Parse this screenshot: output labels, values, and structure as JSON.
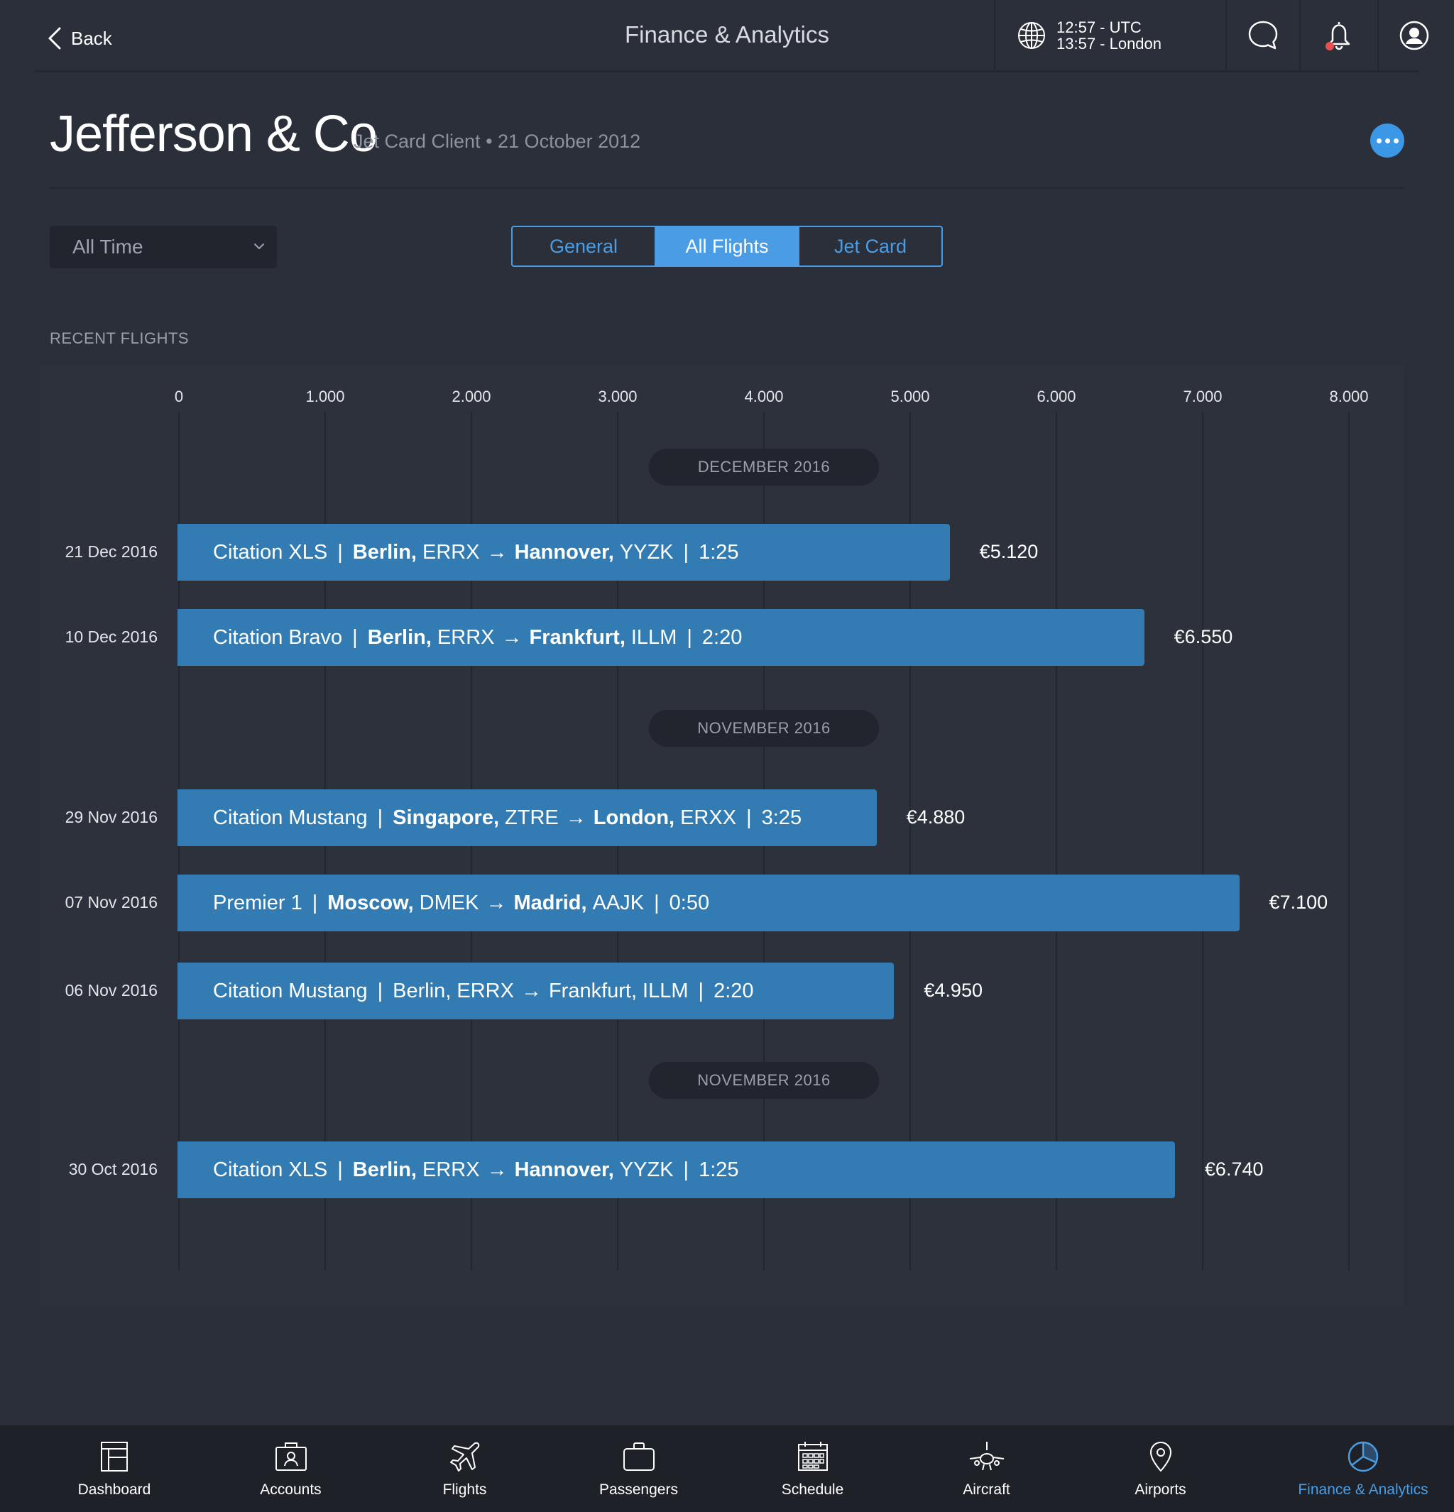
{
  "header": {
    "back_label": "Back",
    "title": "Finance & Analytics",
    "clock": {
      "utc": "12:57 - UTC",
      "local": "13:57 - London"
    },
    "notification_dot_color": "#e8504f"
  },
  "client": {
    "name": "Jefferson & Co",
    "meta": "Jet Card Client • 21 October 2012"
  },
  "filters": {
    "timeframe": "All Time",
    "tabs": [
      {
        "label": "General",
        "active": false
      },
      {
        "label": "All Flights",
        "active": true
      },
      {
        "label": "Jet Card",
        "active": false
      }
    ]
  },
  "section_label": "RECENT FLIGHTS",
  "chart_data": {
    "type": "bar",
    "orientation": "horizontal",
    "xlim": [
      0,
      8000
    ],
    "ticks": [
      {
        "value": 0,
        "label": "0"
      },
      {
        "value": 1000,
        "label": "1.000"
      },
      {
        "value": 2000,
        "label": "2.000"
      },
      {
        "value": 3000,
        "label": "3.000"
      },
      {
        "value": 4000,
        "label": "4.000"
      },
      {
        "value": 5000,
        "label": "5.000"
      },
      {
        "value": 6000,
        "label": "6.000"
      },
      {
        "value": 7000,
        "label": "7.000"
      },
      {
        "value": 8000,
        "label": "8.000"
      }
    ],
    "groups": [
      {
        "month": "DECEMBER 2016",
        "flights": [
          {
            "date": "21 Dec 2016",
            "aircraft": "Citation XLS",
            "from_city": "Berlin,",
            "from_code": "ERRX",
            "to_city": "Hannover,",
            "to_code": "YYZK",
            "duration": "1:25",
            "value": 5280,
            "value_label": "€5.120",
            "bold_cities": true
          },
          {
            "date": "10 Dec 2016",
            "aircraft": "Citation Bravo",
            "from_city": "Berlin,",
            "from_code": "ERRX",
            "to_city": "Frankfurt,",
            "to_code": "ILLM",
            "duration": "2:20",
            "value": 6610,
            "value_label": "€6.550",
            "bold_cities": true
          }
        ]
      },
      {
        "month": "NOVEMBER 2016",
        "flights": [
          {
            "date": "29 Nov 2016",
            "aircraft": "Citation Mustang",
            "from_city": "Singapore,",
            "from_code": "ZTRE",
            "to_city": "London,",
            "to_code": "ERXX",
            "duration": "3:25",
            "value": 4780,
            "value_label": "€4.880",
            "bold_cities": true
          },
          {
            "date": "07 Nov 2016",
            "aircraft": "Premier 1",
            "from_city": "Moscow,",
            "from_code": "DMEK",
            "to_city": "Madrid,",
            "to_code": "AAJK",
            "duration": "0:50",
            "value": 7260,
            "value_label": "€7.100",
            "bold_cities": true
          },
          {
            "date": "06 Nov 2016",
            "aircraft": "Citation Mustang",
            "from_city": "Berlin,",
            "from_code": "ERRX",
            "to_city": "Frankfurt,",
            "to_code": "ILLM",
            "duration": "2:20",
            "value": 4900,
            "value_label": "€4.950",
            "bold_cities": false
          }
        ]
      },
      {
        "month": "NOVEMBER 2016",
        "flights": [
          {
            "date": "30 Oct 2016",
            "aircraft": "Citation XLS",
            "from_city": "Berlin,",
            "from_code": "ERRX",
            "to_city": "Hannover,",
            "to_code": "YYZK",
            "duration": "1:25",
            "value": 6820,
            "value_label": "€6.740",
            "bold_cities": true
          }
        ]
      }
    ],
    "colors": {
      "bar": "#337cb3",
      "grid": "#23262e"
    }
  },
  "nav": {
    "items": [
      {
        "label": "Dashboard",
        "icon": "dashboard-icon",
        "active": false
      },
      {
        "label": "Accounts",
        "icon": "accounts-icon",
        "active": false
      },
      {
        "label": "Flights",
        "icon": "airplane-icon",
        "active": false
      },
      {
        "label": "Passengers",
        "icon": "briefcase-icon",
        "active": false
      },
      {
        "label": "Schedule",
        "icon": "calendar-icon",
        "active": false
      },
      {
        "label": "Aircraft",
        "icon": "jet-icon",
        "active": false
      },
      {
        "label": "Airports",
        "icon": "location-pin-icon",
        "active": false
      },
      {
        "label": "Finance & Analytics",
        "icon": "pie-chart-icon",
        "active": true
      }
    ],
    "active_color": "#4a9de4"
  }
}
